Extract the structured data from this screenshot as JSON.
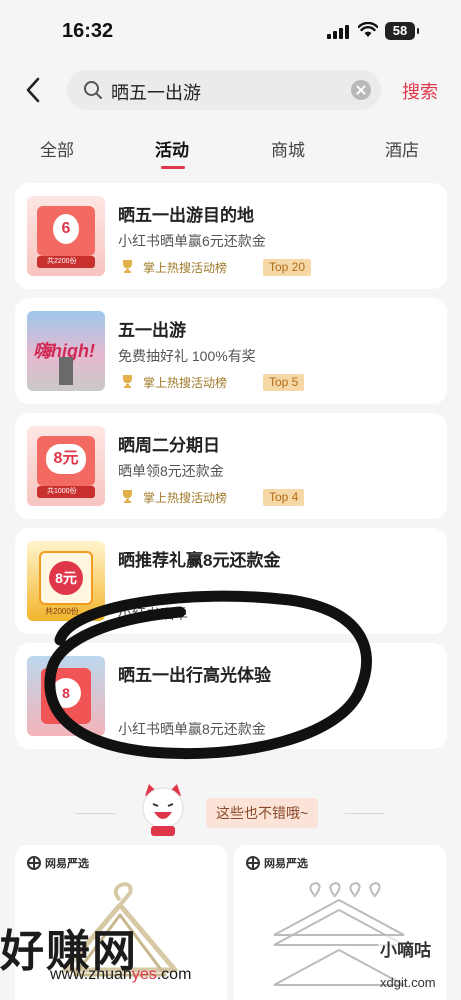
{
  "status_bar": {
    "time": "16:32",
    "battery": "58"
  },
  "search": {
    "query": "晒五一出游",
    "button_label": "搜索"
  },
  "tabs": [
    {
      "label": "全部",
      "active": false
    },
    {
      "label": "活动",
      "active": true
    },
    {
      "label": "商城",
      "active": false
    },
    {
      "label": "酒店",
      "active": false
    }
  ],
  "cards": [
    {
      "title": "晒五一出游目的地",
      "subtitle": "小红书晒单赢6元还款金",
      "rank_label": "掌上热搜活动榜",
      "rank_badge": "Top 20",
      "thumb_text": "6",
      "thumb_caption": "共2200份"
    },
    {
      "title": "五一出游",
      "subtitle": "免费抽好礼 100%有奖",
      "rank_label": "掌上热搜活动榜",
      "rank_badge": "Top 5",
      "thumb_text": "嗨high!"
    },
    {
      "title": "晒周二分期日",
      "subtitle": "晒单领8元还款金",
      "rank_label": "掌上热搜活动榜",
      "rank_badge": "Top 4",
      "thumb_text": "8元",
      "thumb_caption": "共1000份"
    },
    {
      "title": "晒推荐礼赢8元还款金",
      "subtitle": "小红书晒单",
      "thumb_text": "8元",
      "thumb_caption": "共2000份"
    },
    {
      "title": "晒五一出行高光体验",
      "subtitle": "小红书晒单赢8元还款金",
      "thumb_text": "8"
    }
  ],
  "divider": {
    "label": "这些也不错哦~"
  },
  "products": [
    {
      "brand": "网易严选"
    },
    {
      "brand": "网易严选"
    }
  ],
  "watermarks": {
    "left_big": "好赚网",
    "left_url_a": "www.zhuan",
    "left_url_b": "yes",
    "left_url_c": ".com",
    "right_name": "小嘀咕",
    "right_url": "xdgit.com"
  },
  "colors": {
    "accent": "#e0364a",
    "rank_text": "#a07a2a",
    "rank_badge_bg": "#f6d8a6"
  }
}
